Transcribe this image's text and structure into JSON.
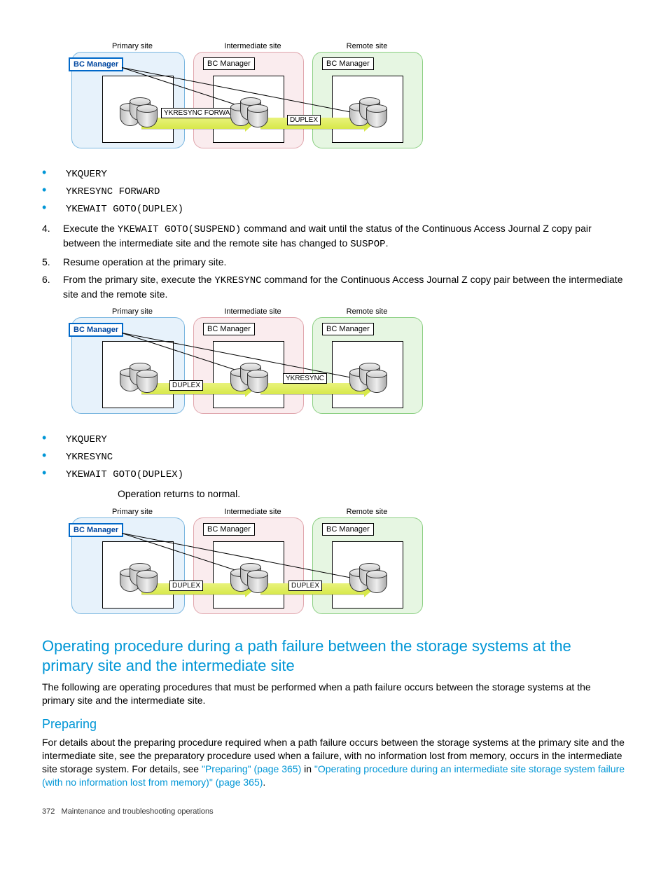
{
  "diagram_labels": {
    "primary": "Primary site",
    "intermediate": "Intermediate site",
    "remote": "Remote site",
    "bc_manager": "BC Manager"
  },
  "diagram1": {
    "arrow1_label": "YKRESYNC FORWARD",
    "arrow2_label": "DUPLEX"
  },
  "cmdlist1": {
    "i0": "YKQUERY",
    "i1": "YKRESYNC FORWARD",
    "i2": "YKEWAIT GOTO(DUPLEX)"
  },
  "step4": {
    "num": "4.",
    "pre": "Execute the ",
    "code": "YKEWAIT GOTO(SUSPEND)",
    "mid": " command and wait until the status of the Continuous Access Journal Z copy pair between the intermediate site and the remote site has changed to ",
    "code2": "SUSPOP",
    "end": "."
  },
  "step5": {
    "num": "5.",
    "text": "Resume operation at the primary site."
  },
  "step6": {
    "num": "6.",
    "pre": "From the primary site, execute the ",
    "code": "YKRESYNC",
    "end": " command for the Continuous Access Journal Z copy pair between the intermediate site and the remote site."
  },
  "diagram2": {
    "arrow1_label": "DUPLEX",
    "arrow2_label": "YKRESYNC"
  },
  "cmdlist2": {
    "i0": "YKQUERY",
    "i1": "YKRESYNC",
    "i2": "YKEWAIT GOTO(DUPLEX)"
  },
  "returns_text": "Operation returns to normal.",
  "diagram3": {
    "arrow1_label": "DUPLEX",
    "arrow2_label": "DUPLEX"
  },
  "section_heading": "Operating procedure during a path failure between the storage systems at the primary site and the intermediate site",
  "section_para": "The following are operating procedures that must be performed when a path failure occurs between the storage systems at the primary site and the intermediate site.",
  "sub_heading": "Preparing",
  "sub_para_pre": "For details about the preparing procedure required when a path failure occurs between the storage systems at the primary site and the intermediate site, see the preparatory procedure used when a failure, with no information lost from memory, occurs in the intermediate site storage system. For details, see ",
  "link1": "\"Preparing\" (page 365)",
  "sub_para_mid": " in ",
  "link2": "\"Operating procedure during an intermediate site storage system failure (with no information lost from memory)\" (page 365)",
  "sub_para_end": ".",
  "footer_page": "372",
  "footer_text": "Maintenance and troubleshooting operations"
}
